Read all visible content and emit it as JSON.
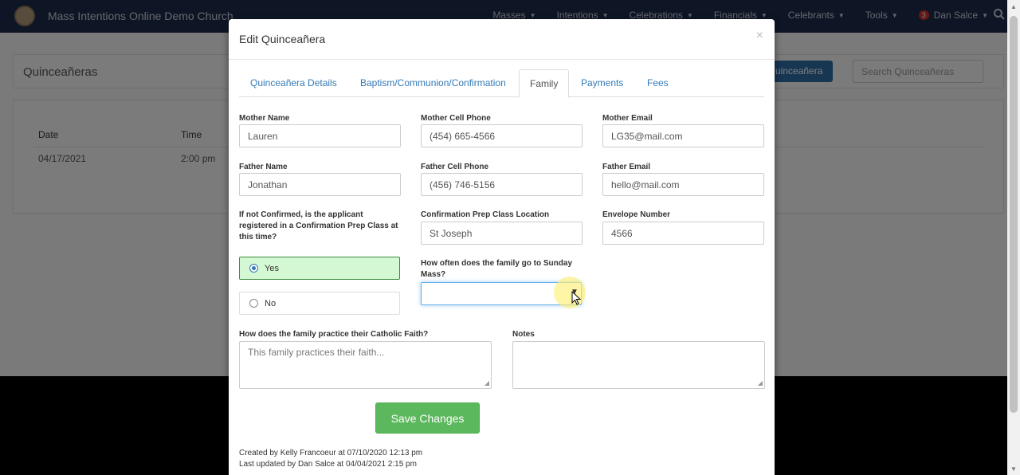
{
  "navbar": {
    "brand": "Mass Intentions Online Demo Church",
    "menu": [
      "Masses",
      "Intentions",
      "Celebrations",
      "Financials",
      "Celebrants",
      "Tools"
    ],
    "user_badge": "3",
    "user_name": "Dan Salce"
  },
  "background": {
    "page_title": "Quinceañeras",
    "add_button_label": "uinceañera",
    "search_placeholder": "Search Quinceañeras",
    "columns": [
      "Date",
      "Time"
    ],
    "rows": [
      [
        "04/17/2021",
        "2:00 pm"
      ]
    ]
  },
  "modal": {
    "title": "Edit Quinceañera",
    "close": "×",
    "tabs": [
      "Quinceañera Details",
      "Baptism/Communion/Confirmation",
      "Family",
      "Payments",
      "Fees"
    ],
    "active_tab": "Family",
    "fields": {
      "mother_name": {
        "label": "Mother Name",
        "value": "Lauren"
      },
      "mother_cell": {
        "label": "Mother Cell Phone",
        "value": "(454) 665-4566"
      },
      "mother_email": {
        "label": "Mother Email",
        "value": "LG35@mail.com"
      },
      "father_name": {
        "label": "Father Name",
        "value": "Jonathan"
      },
      "father_cell": {
        "label": "Father Cell Phone",
        "value": "(456) 746-5156"
      },
      "father_email": {
        "label": "Father Email",
        "value": "hello@mail.com"
      },
      "prep_question": {
        "label": "If not Confirmed, is the applicant registered in a Confirmation Prep Class at this time?"
      },
      "prep_location": {
        "label": "Confirmation Prep Class Location",
        "value": "St Joseph"
      },
      "envelope": {
        "label": "Envelope Number",
        "value": "4566"
      },
      "mass_frequency": {
        "label": "How often does the family go to Sunday Mass?",
        "value": ""
      },
      "practice": {
        "label": "How does the family practice their Catholic Faith?",
        "placeholder": "This family practices their faith..."
      },
      "notes": {
        "label": "Notes",
        "value": ""
      }
    },
    "radio": {
      "yes": "Yes",
      "no": "No",
      "selected": "Yes"
    },
    "save_label": "Save Changes",
    "created": "Created by Kelly Francoeur at 07/10/2020 12:13 pm",
    "updated": "Last updated by Dan Salce at 04/04/2021 2:15 pm"
  },
  "colors": {
    "navbar": "#1c2b4a",
    "link": "#337ab7",
    "success": "#5cb85c",
    "selected_radio_bg": "#d4f7d4"
  }
}
